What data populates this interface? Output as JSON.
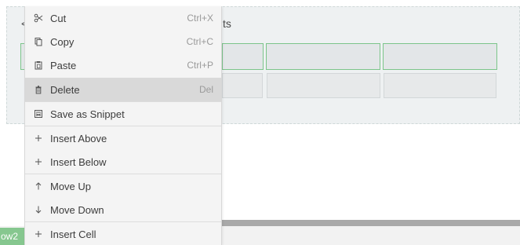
{
  "panel": {
    "title_prefix": "<",
    "title_suffix": "ts"
  },
  "row_tag": "ow2",
  "menu": {
    "items": [
      {
        "label": "Cut",
        "shortcut": "Ctrl+X",
        "icon": "scissors-icon"
      },
      {
        "label": "Copy",
        "shortcut": "Ctrl+C",
        "icon": "copy-icon"
      },
      {
        "label": "Paste",
        "shortcut": "Ctrl+P",
        "icon": "paste-icon"
      },
      {
        "label": "Delete",
        "shortcut": "Del",
        "icon": "trash-icon",
        "highlighted": true
      },
      {
        "label": "Save as Snippet",
        "shortcut": "",
        "icon": "snippet-icon"
      },
      {
        "label": "Insert Above",
        "shortcut": "",
        "icon": "plus-icon"
      },
      {
        "label": "Insert Below",
        "shortcut": "",
        "icon": "plus-icon"
      },
      {
        "label": "Move Up",
        "shortcut": "",
        "icon": "arrow-up-icon"
      },
      {
        "label": "Move Down",
        "shortcut": "",
        "icon": "arrow-down-icon"
      },
      {
        "label": "Insert Cell",
        "shortcut": "",
        "icon": "plus-icon"
      }
    ]
  },
  "colors": {
    "selection_border": "#7cc58a",
    "row_tag_bg": "#86c78f",
    "menu_highlight": "#d9d9d9"
  }
}
